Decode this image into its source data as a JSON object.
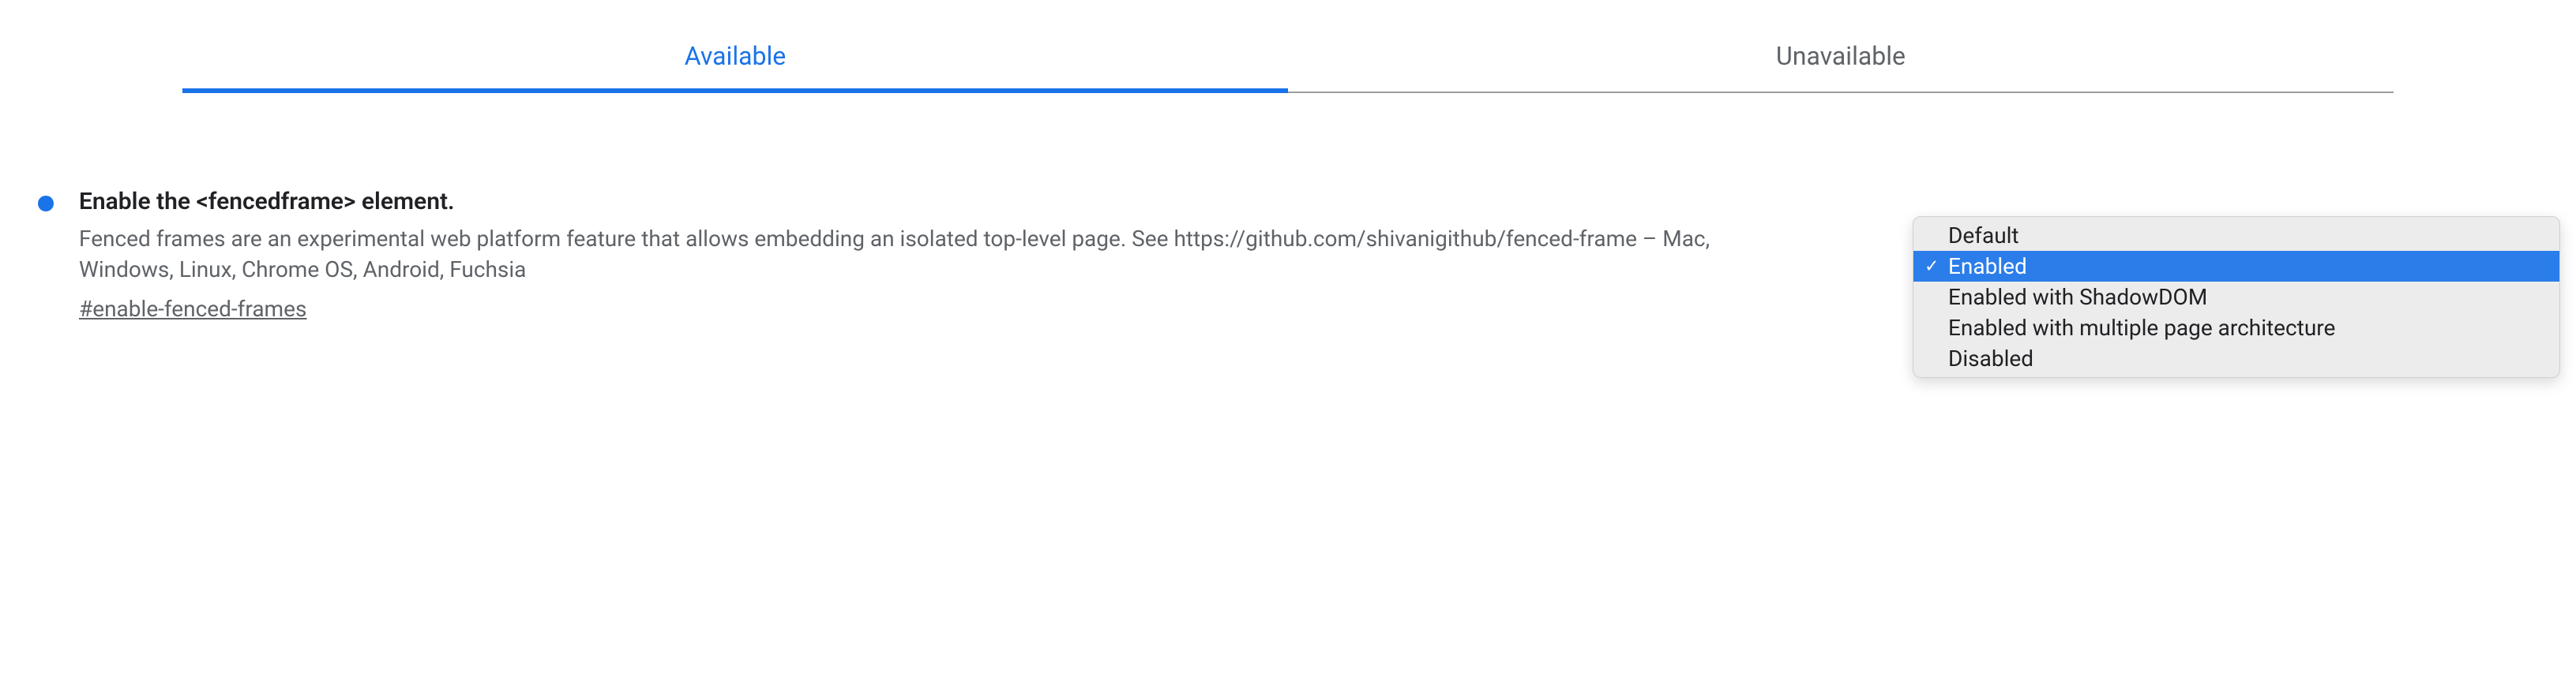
{
  "tabs": {
    "available": "Available",
    "unavailable": "Unavailable"
  },
  "flag": {
    "title": "Enable the <fencedframe> element.",
    "description": "Fenced frames are an experimental web platform feature that allows embedding an isolated top-level page. See https://github.com/shivanigithub/fenced-frame – Mac, Windows, Linux, Chrome OS, Android, Fuchsia",
    "hash": "#enable-fenced-frames"
  },
  "dropdown": {
    "options": {
      "default": "Default",
      "enabled": "Enabled",
      "enabled_shadowdom": "Enabled with ShadowDOM",
      "enabled_multi": "Enabled with multiple page architecture",
      "disabled": "Disabled"
    }
  }
}
